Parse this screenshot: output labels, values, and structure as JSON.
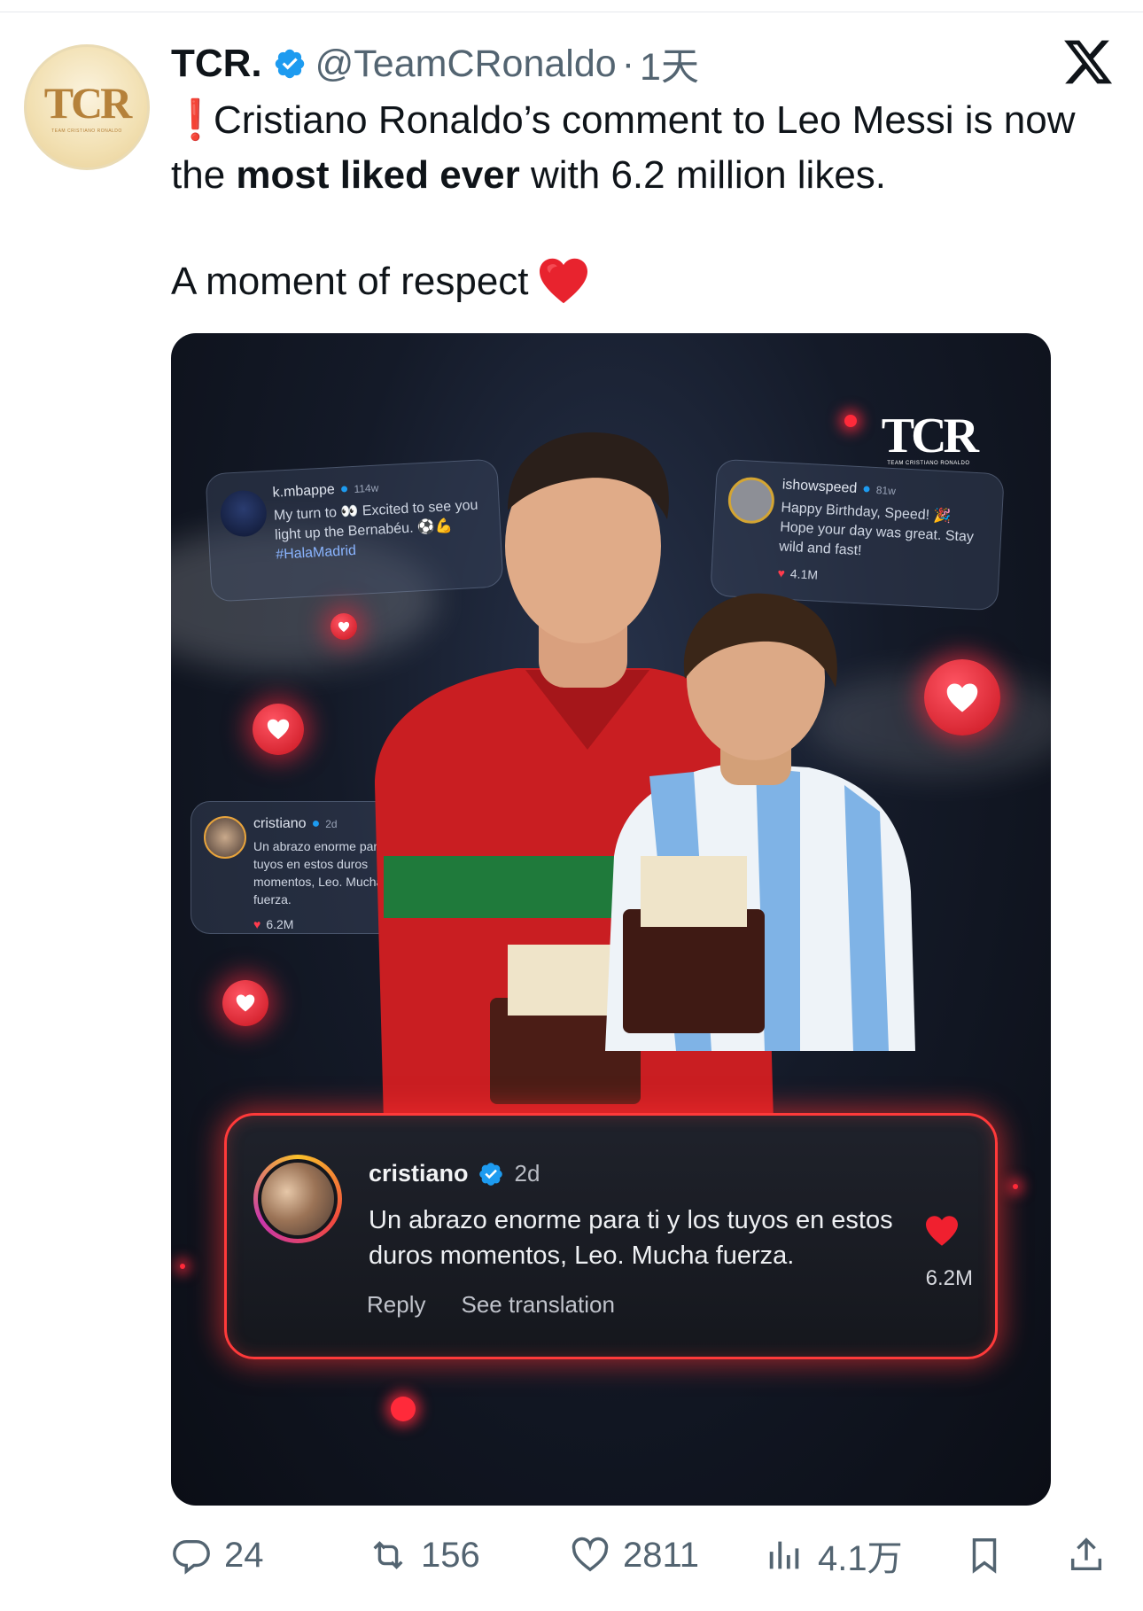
{
  "tweet": {
    "display_name": "TCR.",
    "handle": "@TeamCRonaldo",
    "separator": "·",
    "time": "1天",
    "text_line1": "Cristiano Ronaldo’s comment to Leo Messi is now the ",
    "text_bold": "most liked ever",
    "text_line1_end": " with 6.2 million likes.",
    "text_line2": "A moment of respect",
    "exclaim": "❗"
  },
  "avatar": {
    "logo": "TCR",
    "sub": "TEAM CRISTIANO RONALDO"
  },
  "media": {
    "watermark_logo": "TCR",
    "watermark_sub": "TEAM CRISTIANO RONALDO",
    "ghost_cards": [
      {
        "user": "k.mbappe",
        "meta": "114w",
        "body": "My turn to 👀 Excited to see you light up the Bernabéu. ⚽💪",
        "tag": "#HalaMadrid",
        "likes": ""
      },
      {
        "user": "ishowspeed",
        "meta": "81w",
        "body": "Happy Birthday, Speed! 🎉 Hope your day was great. Stay wild and fast!",
        "tag": "",
        "likes": "4.1M"
      },
      {
        "user": "cristiano",
        "meta": "2d",
        "body": "Un abrazo enorme para ti y los tuyos en estos duros momentos, Leo. Mucha fuerza.",
        "tag": "",
        "likes": "6.2M"
      }
    ],
    "featured_comment": {
      "user": "cristiano",
      "time": "2d",
      "text": "Un abrazo enorme para ti y los tuyos en estos duros momentos, Leo. Mucha fuerza.",
      "reply": "Reply",
      "translate": "See translation",
      "likes": "6.2M"
    }
  },
  "actions": {
    "replies": "24",
    "retweets": "156",
    "likes": "2811",
    "views": "4.1万"
  },
  "colors": {
    "verified": "#1d9bf0",
    "accent_red": "#ff3a3a"
  }
}
